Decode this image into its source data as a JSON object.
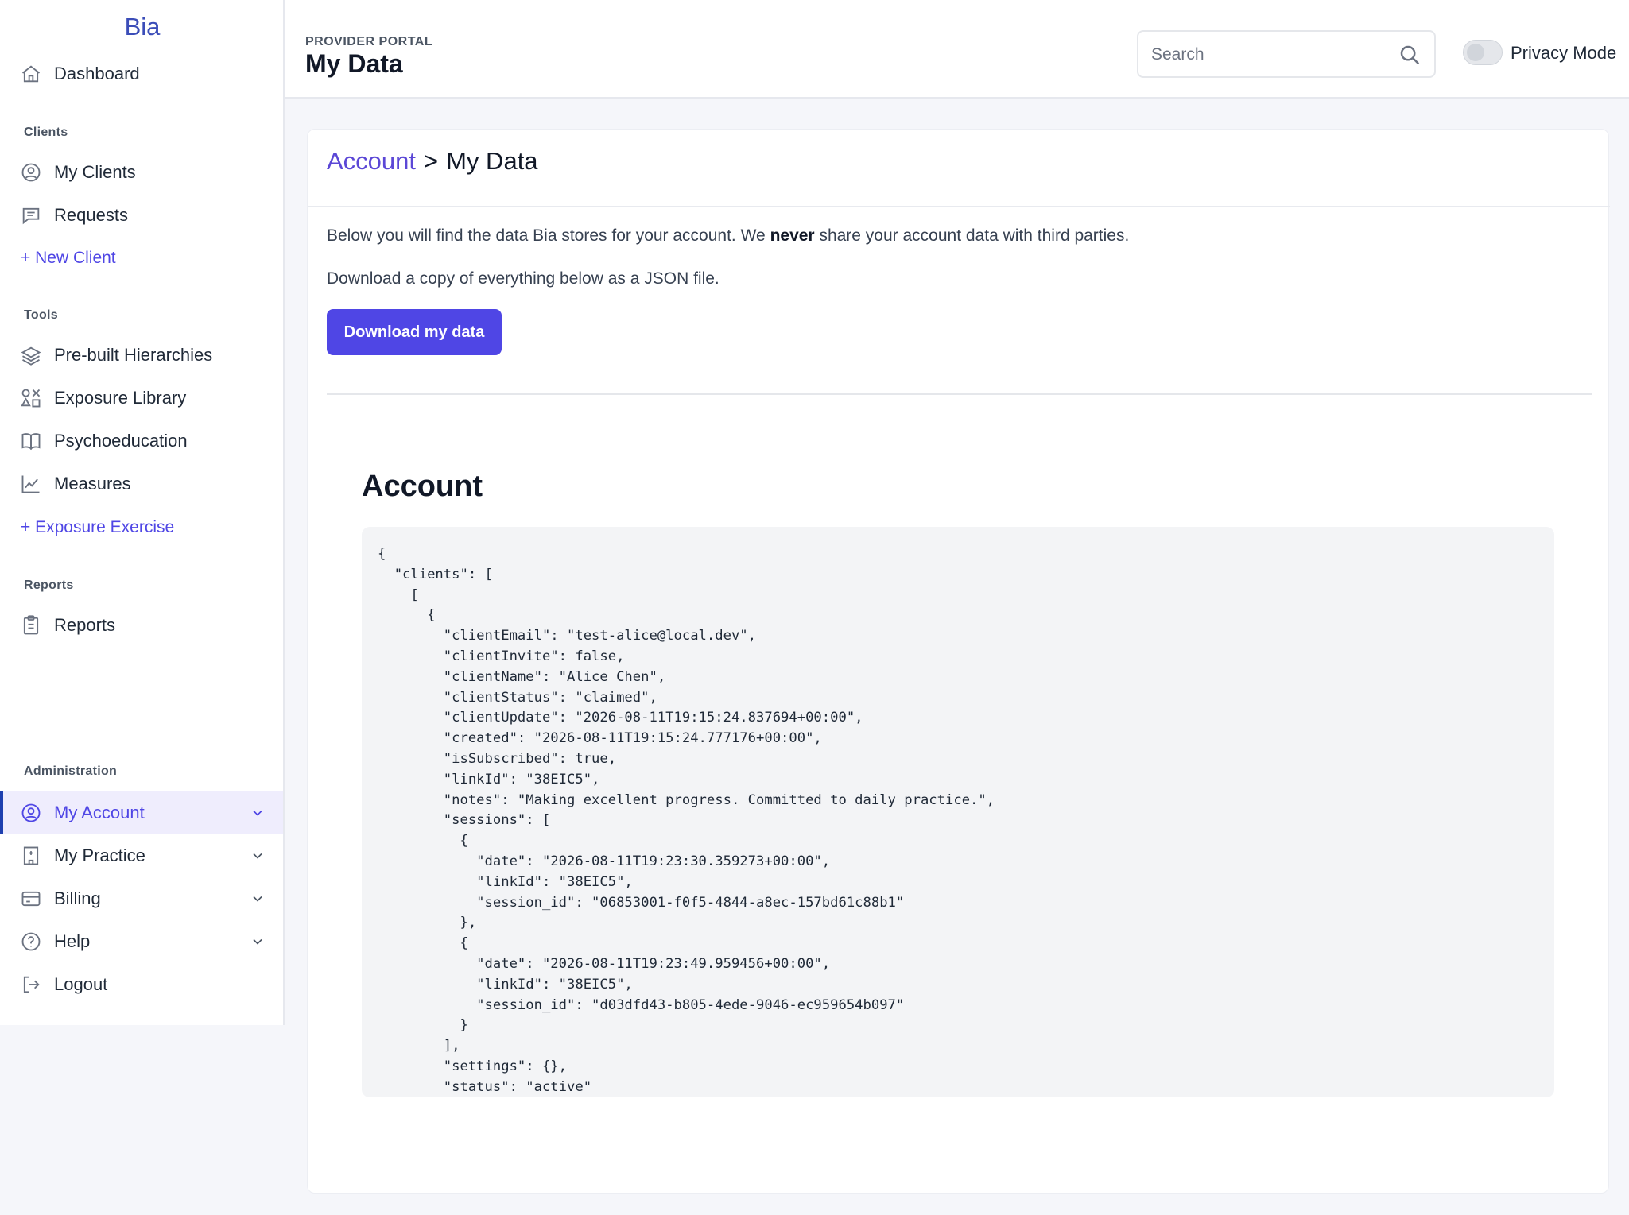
{
  "app": {
    "logo": "Bia"
  },
  "sidebar": {
    "dashboard": "Dashboard",
    "sections": {
      "clients": "Clients",
      "tools": "Tools",
      "reports": "Reports",
      "administration": "Administration"
    },
    "clients_items": [
      "My Clients",
      "Requests"
    ],
    "new_client": "+ New Client",
    "tools_items": [
      "Pre-built Hierarchies",
      "Exposure Library",
      "Psychoeducation",
      "Measures"
    ],
    "new_exposure": "+ Exposure Exercise",
    "reports_items": [
      "Reports"
    ],
    "admin_items": [
      "My Account",
      "My Practice",
      "Billing",
      "Help",
      "Logout"
    ]
  },
  "header": {
    "portal_label": "PROVIDER PORTAL",
    "title": "My Data",
    "search_placeholder": "Search",
    "privacy_label": "Privacy Mode"
  },
  "content": {
    "breadcrumb_link": "Account",
    "breadcrumb_sep": ">",
    "breadcrumb_current": "My Data",
    "intro_before": "Below you will find the data Bia stores for your account. We ",
    "intro_strong": "never",
    "intro_after": " share your account data with third parties.",
    "intro2": "Download a copy of everything below as a JSON file.",
    "download_button": "Download my data",
    "section_title": "Account",
    "json_text": "{\n  \"clients\": [\n    [\n      {\n        \"clientEmail\": \"test-alice@local.dev\",\n        \"clientInvite\": false,\n        \"clientName\": \"Alice Chen\",\n        \"clientStatus\": \"claimed\",\n        \"clientUpdate\": \"2026-08-11T19:15:24.837694+00:00\",\n        \"created\": \"2026-08-11T19:15:24.777176+00:00\",\n        \"isSubscribed\": true,\n        \"linkId\": \"38EIC5\",\n        \"notes\": \"Making excellent progress. Committed to daily practice.\",\n        \"sessions\": [\n          {\n            \"date\": \"2026-08-11T19:23:30.359273+00:00\",\n            \"linkId\": \"38EIC5\",\n            \"session_id\": \"06853001-f0f5-4844-a8ec-157bd61c88b1\"\n          },\n          {\n            \"date\": \"2026-08-11T19:23:49.959456+00:00\",\n            \"linkId\": \"38EIC5\",\n            \"session_id\": \"d03dfd43-b805-4ede-9046-ec959654b097\"\n          }\n        ],\n        \"settings\": {},\n        \"status\": \"active\"\n      },"
  },
  "icons": {
    "dashboard": "home-icon",
    "my_clients": "user-circle-icon",
    "requests": "chat-icon",
    "hierarchies": "layers-icon",
    "exposure_library": "shapes-icon",
    "psychoeducation": "book-icon",
    "measures": "chart-line-icon",
    "reports": "clipboard-icon",
    "my_account": "user-circle-icon",
    "my_practice": "building-icon",
    "billing": "card-icon",
    "help": "question-circle-icon",
    "logout": "logout-icon",
    "search": "search-icon"
  },
  "colors": {
    "accent": "#4f46e5",
    "active_bg": "#efedfd",
    "logo": "#3b4db8"
  }
}
